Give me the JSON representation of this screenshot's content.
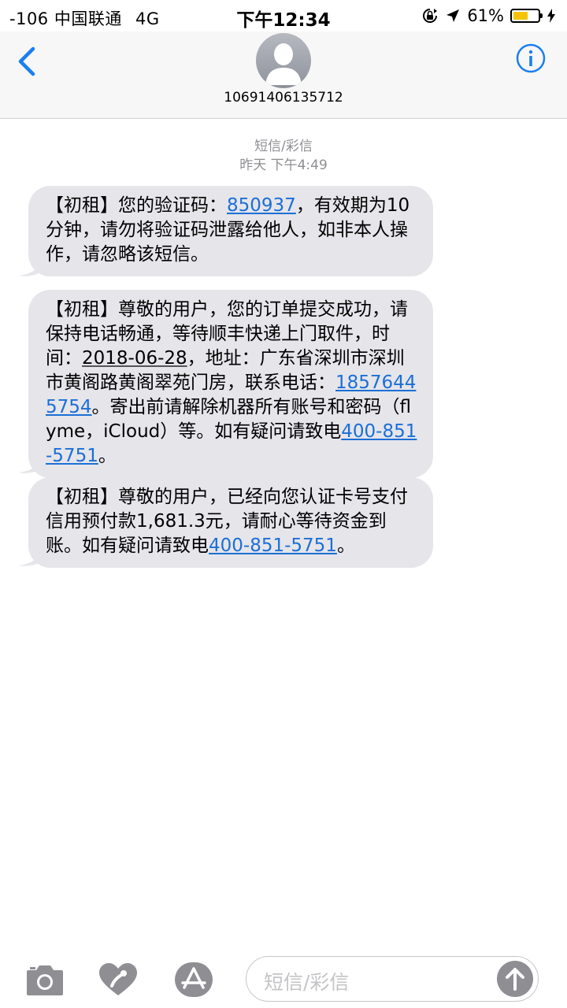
{
  "status_bar": {
    "carrier": "-106 中国联通",
    "network": "4G",
    "time": "下午12:34",
    "battery_percent": "61%",
    "battery_level": 0.61
  },
  "nav": {
    "contact": "10691406135712"
  },
  "thread": {
    "service": "短信/彩信",
    "time": "昨天 下午4:49"
  },
  "messages": [
    {
      "prefix": "【初租】您的验证码：",
      "code": "850937",
      "suffix": "，有效期为10分钟，请勿将验证码泄露给他人，如非本人操作，请忽略该短信。"
    },
    {
      "prefix": "【初租】尊敬的用户，您的订单提交成功，请保持电话畅通，等待顺丰快递上门取件，时间：",
      "date": "2018-06-28",
      "middle": "，地址：广东省深圳市深圳市黄阁路黄阁翠苑门房，联系电话：",
      "phone1": "18576445754",
      "middle2": "。寄出前请解除机器所有账号和密码（flyme，iCloud）等。如有疑问请致电",
      "phone2": "400-851-5751",
      "suffix": "。"
    },
    {
      "prefix": "【初租】尊敬的用户，已经向您认证卡号支付信用预付款1,681.3元，请耐心等待资金到账。如有疑问请致电",
      "phone": "400-851-5751",
      "suffix": "。"
    }
  ],
  "input": {
    "placeholder": "短信/彩信"
  },
  "colors": {
    "link": "#1b6fd6",
    "bubble": "#e5e5ea",
    "accent": "#1a7ef0",
    "battery": "#f5c400"
  },
  "icons": [
    "back-chevron-icon",
    "avatar-person-icon",
    "info-icon",
    "camera-icon",
    "digital-touch-heart-icon",
    "app-store-icon",
    "send-arrow-icon",
    "location-arrow-icon",
    "orientation-lock-icon",
    "battery-icon",
    "charging-bolt-icon"
  ]
}
